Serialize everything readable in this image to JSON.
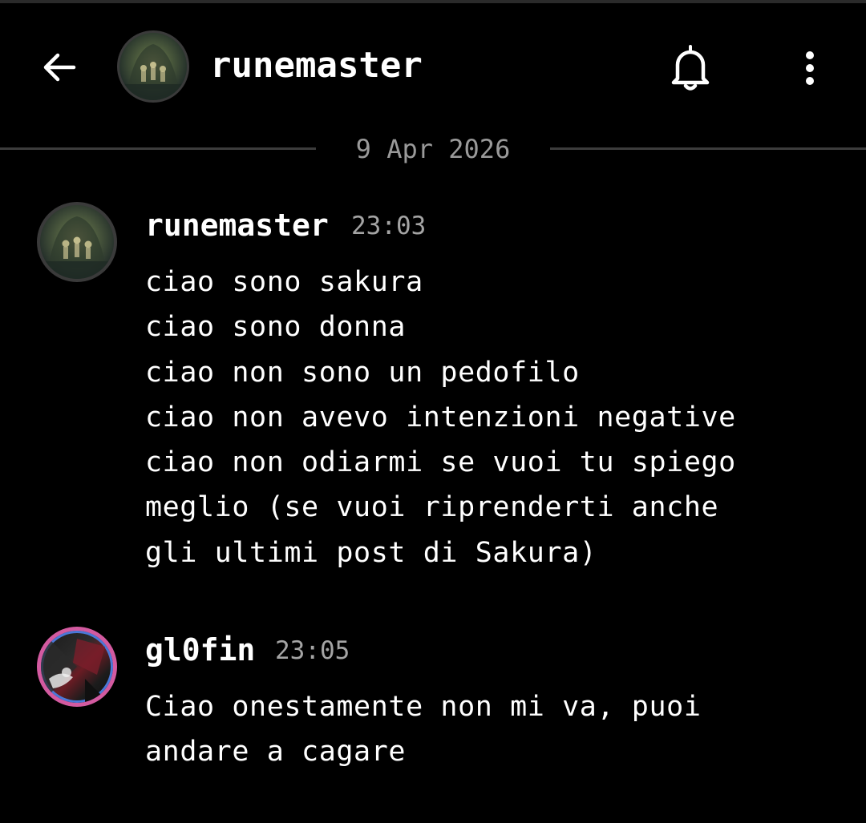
{
  "header": {
    "back_icon": "arrow-left-icon",
    "avatar_icon": "avatar-image",
    "title": "runemaster",
    "bell_icon": "bell-icon",
    "more_icon": "more-vertical-icon"
  },
  "date_divider": {
    "label": "9 Apr 2026"
  },
  "messages": [
    {
      "author": "runemaster",
      "time": "23:03",
      "lines": [
        "ciao sono sakura",
        "ciao sono donna",
        "ciao non sono un pedofilo",
        "ciao non avevo intenzioni negative",
        "ciao non odiarmi se vuoi tu spiego",
        "meglio (se vuoi riprenderti anche",
        "gli ultimi post di Sakura)"
      ]
    },
    {
      "author": "gl0fin",
      "time": "23:05",
      "lines": [
        "Ciao onestamente non mi va, puoi",
        "andare a cagare"
      ]
    }
  ],
  "colors": {
    "background": "#000000",
    "text": "#ffffff",
    "muted": "#9a9a9a",
    "divider": "#3c3c3c"
  }
}
